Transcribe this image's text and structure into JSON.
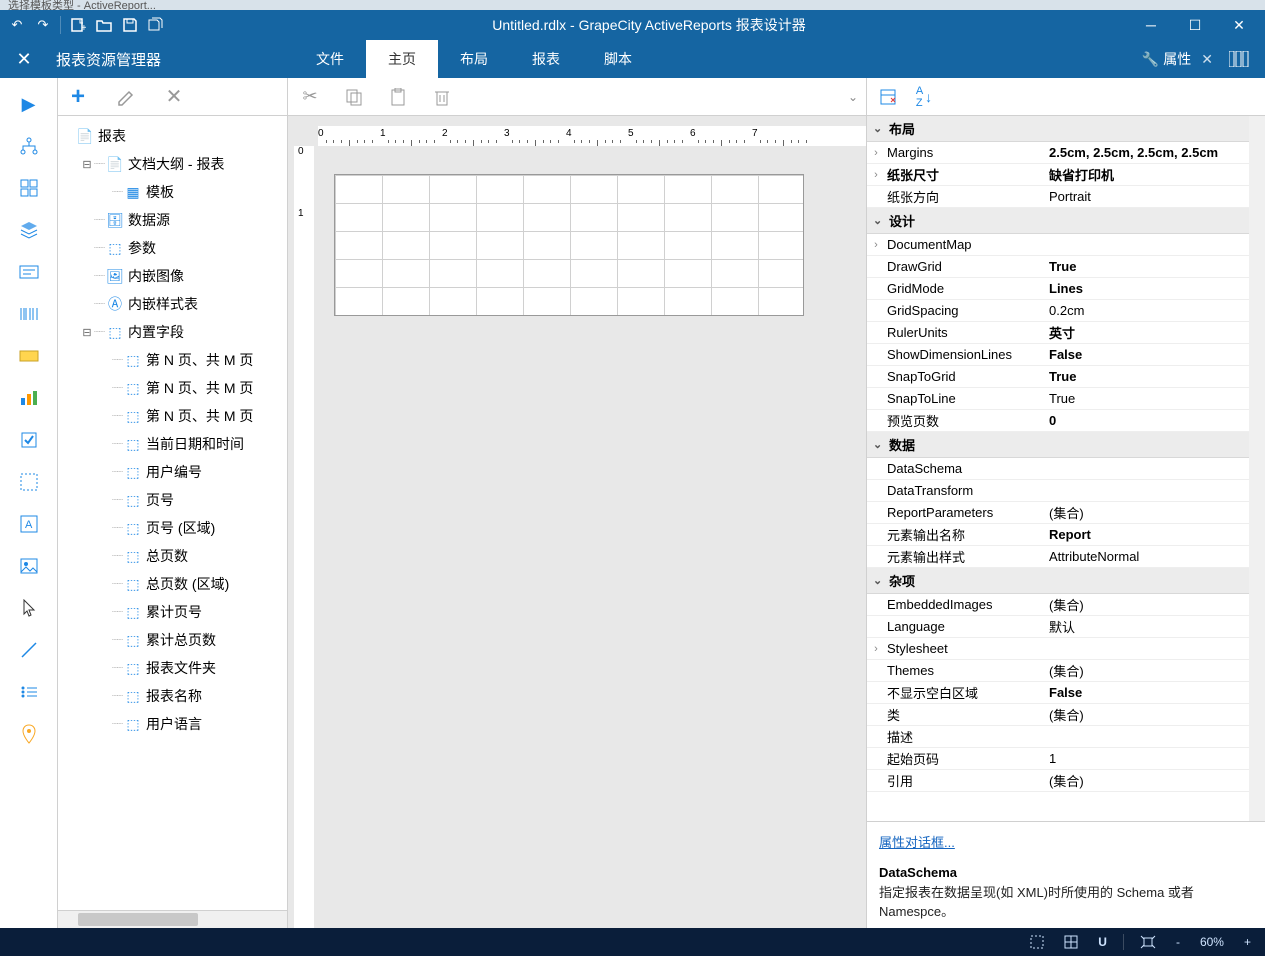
{
  "top_chrome": {
    "tab_hint": "选择模板类型 - ActiveReport..."
  },
  "titlebar": {
    "title": "Untitled.rdlx - GrapeCity ActiveReports 报表设计器"
  },
  "ribbon": {
    "pane_title": "报表资源管理器",
    "tabs": [
      "文件",
      "主页",
      "布局",
      "报表",
      "脚本"
    ],
    "active_tab": 1,
    "props_label": "属性"
  },
  "explorer": {
    "tree": [
      {
        "lvl": 0,
        "twisty": "",
        "icon": "📄",
        "label": "报表"
      },
      {
        "lvl": 1,
        "twisty": "⊟",
        "icon": "📄",
        "label": "文档大纲 - 报表"
      },
      {
        "lvl": 2,
        "twisty": "",
        "icon": "▦",
        "label": "模板"
      },
      {
        "lvl": 1,
        "twisty": "",
        "icon": "🗄",
        "label": "数据源"
      },
      {
        "lvl": 1,
        "twisty": "",
        "icon": "⬚",
        "label": "参数"
      },
      {
        "lvl": 1,
        "twisty": "",
        "icon": "🖼",
        "label": "内嵌图像"
      },
      {
        "lvl": 1,
        "twisty": "",
        "icon": "Ⓐ",
        "label": "内嵌样式表"
      },
      {
        "lvl": 1,
        "twisty": "⊟",
        "icon": "⬚",
        "label": "内置字段"
      },
      {
        "lvl": 2,
        "twisty": "",
        "icon": "⬚",
        "label": "第 N 页、共 M 页"
      },
      {
        "lvl": 2,
        "twisty": "",
        "icon": "⬚",
        "label": "第 N 页、共 M 页"
      },
      {
        "lvl": 2,
        "twisty": "",
        "icon": "⬚",
        "label": "第 N 页、共 M 页"
      },
      {
        "lvl": 2,
        "twisty": "",
        "icon": "⬚",
        "label": "当前日期和时间"
      },
      {
        "lvl": 2,
        "twisty": "",
        "icon": "⬚",
        "label": "用户编号"
      },
      {
        "lvl": 2,
        "twisty": "",
        "icon": "⬚",
        "label": "页号"
      },
      {
        "lvl": 2,
        "twisty": "",
        "icon": "⬚",
        "label": "页号 (区域)"
      },
      {
        "lvl": 2,
        "twisty": "",
        "icon": "⬚",
        "label": "总页数"
      },
      {
        "lvl": 2,
        "twisty": "",
        "icon": "⬚",
        "label": "总页数 (区域)"
      },
      {
        "lvl": 2,
        "twisty": "",
        "icon": "⬚",
        "label": "累计页号"
      },
      {
        "lvl": 2,
        "twisty": "",
        "icon": "⬚",
        "label": "累计总页数"
      },
      {
        "lvl": 2,
        "twisty": "",
        "icon": "⬚",
        "label": "报表文件夹"
      },
      {
        "lvl": 2,
        "twisty": "",
        "icon": "⬚",
        "label": "报表名称"
      },
      {
        "lvl": 2,
        "twisty": "",
        "icon": "⬚",
        "label": "用户语言"
      }
    ]
  },
  "properties": {
    "categories": [
      {
        "name": "布局",
        "rows": [
          {
            "exp": "›",
            "k": "Margins",
            "v": "2.5cm, 2.5cm, 2.5cm, 2.5cm",
            "bold": true
          },
          {
            "exp": "›",
            "k": "纸张尺寸",
            "v": "缺省打印机",
            "bold": true,
            "kbold": true
          },
          {
            "exp": "",
            "k": "纸张方向",
            "v": "Portrait"
          }
        ]
      },
      {
        "name": "设计",
        "rows": [
          {
            "exp": "›",
            "k": "DocumentMap",
            "v": ""
          },
          {
            "exp": "",
            "k": "DrawGrid",
            "v": "True",
            "bold": true
          },
          {
            "exp": "",
            "k": "GridMode",
            "v": "Lines",
            "bold": true
          },
          {
            "exp": "",
            "k": "GridSpacing",
            "v": "0.2cm"
          },
          {
            "exp": "",
            "k": "RulerUnits",
            "v": "英寸",
            "bold": true
          },
          {
            "exp": "",
            "k": "ShowDimensionLines",
            "v": "False",
            "bold": true
          },
          {
            "exp": "",
            "k": "SnapToGrid",
            "v": "True",
            "bold": true
          },
          {
            "exp": "",
            "k": "SnapToLine",
            "v": "True"
          },
          {
            "exp": "",
            "k": "预览页数",
            "v": "0",
            "bold": true
          }
        ]
      },
      {
        "name": "数据",
        "rows": [
          {
            "exp": "",
            "k": "DataSchema",
            "v": ""
          },
          {
            "exp": "",
            "k": "DataTransform",
            "v": ""
          },
          {
            "exp": "",
            "k": "ReportParameters",
            "v": "(集合)"
          },
          {
            "exp": "",
            "k": "元素输出名称",
            "v": "Report",
            "bold": true
          },
          {
            "exp": "",
            "k": "元素输出样式",
            "v": "AttributeNormal"
          }
        ]
      },
      {
        "name": "杂项",
        "rows": [
          {
            "exp": "",
            "k": "EmbeddedImages",
            "v": "(集合)"
          },
          {
            "exp": "",
            "k": "Language",
            "v": "默认"
          },
          {
            "exp": "›",
            "k": "Stylesheet",
            "v": ""
          },
          {
            "exp": "",
            "k": "Themes",
            "v": "(集合)"
          },
          {
            "exp": "",
            "k": "不显示空白区域",
            "v": "False",
            "bold": true
          },
          {
            "exp": "",
            "k": "类",
            "v": "(集合)"
          },
          {
            "exp": "",
            "k": "描述",
            "v": ""
          },
          {
            "exp": "",
            "k": "起始页码",
            "v": "1"
          },
          {
            "exp": "",
            "k": "引用",
            "v": "(集合)"
          }
        ]
      }
    ],
    "link": "属性对话框...",
    "help_header": "DataSchema",
    "help_desc": "指定报表在数据呈现(如 XML)时所使用的 Schema 或者 Namespce。"
  },
  "ruler": {
    "h": [
      "0",
      "1",
      "2",
      "3",
      "4",
      "5",
      "6",
      "7"
    ],
    "v": [
      "0",
      "1"
    ]
  },
  "statusbar": {
    "zoom": "60%",
    "plus": "+",
    "minus": "-"
  }
}
